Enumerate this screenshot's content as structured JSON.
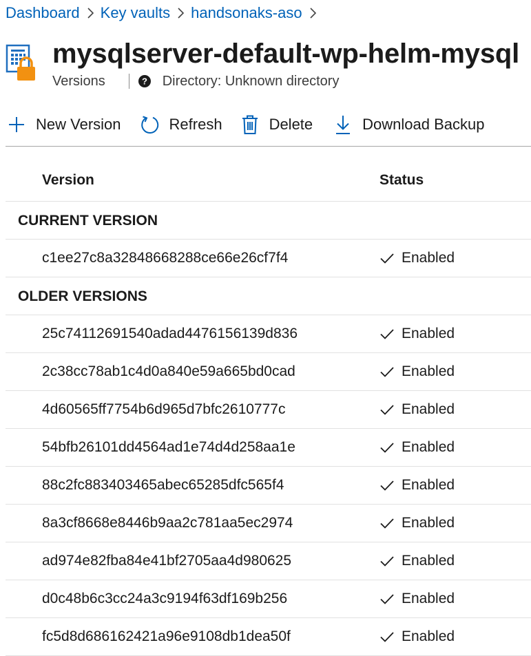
{
  "breadcrumb": [
    {
      "label": "Dashboard"
    },
    {
      "label": "Key vaults"
    },
    {
      "label": "handsonaks-aso"
    }
  ],
  "header": {
    "title": "mysqlserver-default-wp-helm-mysql",
    "subtitle": "Versions",
    "directory": "Directory: Unknown directory",
    "icon": "key-vault-secret-icon"
  },
  "toolbar": {
    "new_version": "New Version",
    "refresh": "Refresh",
    "delete": "Delete",
    "download_backup": "Download Backup"
  },
  "table": {
    "columns": {
      "version": "Version",
      "status": "Status"
    },
    "current_group_label": "CURRENT VERSION",
    "older_group_label": "OLDER VERSIONS",
    "current": [
      {
        "id": "c1ee27c8a32848668288ce66e26cf7f4",
        "status": "Enabled"
      }
    ],
    "older": [
      {
        "id": "25c74112691540adad4476156139d836",
        "status": "Enabled"
      },
      {
        "id": "2c38cc78ab1c4d0a840e59a665bd0cad",
        "status": "Enabled"
      },
      {
        "id": "4d60565ff7754b6d965d7bfc2610777c",
        "status": "Enabled"
      },
      {
        "id": "54bfb26101dd4564ad1e74d4d258aa1e",
        "status": "Enabled"
      },
      {
        "id": "88c2fc883403465abec65285dfc565f4",
        "status": "Enabled"
      },
      {
        "id": "8a3cf8668e8446b9aa2c781aa5ec2974",
        "status": "Enabled"
      },
      {
        "id": "ad974e82fba84e41bf2705aa4d980625",
        "status": "Enabled"
      },
      {
        "id": "d0c48b6c3cc24a3c9194f63df169b256",
        "status": "Enabled"
      },
      {
        "id": "fc5d8d686162421a96e9108db1dea50f",
        "status": "Enabled"
      }
    ]
  },
  "colors": {
    "link": "#0062b8",
    "icon_blue": "#1f6fbf",
    "lock_orange": "#f29111",
    "border": "#e1e1e1"
  }
}
